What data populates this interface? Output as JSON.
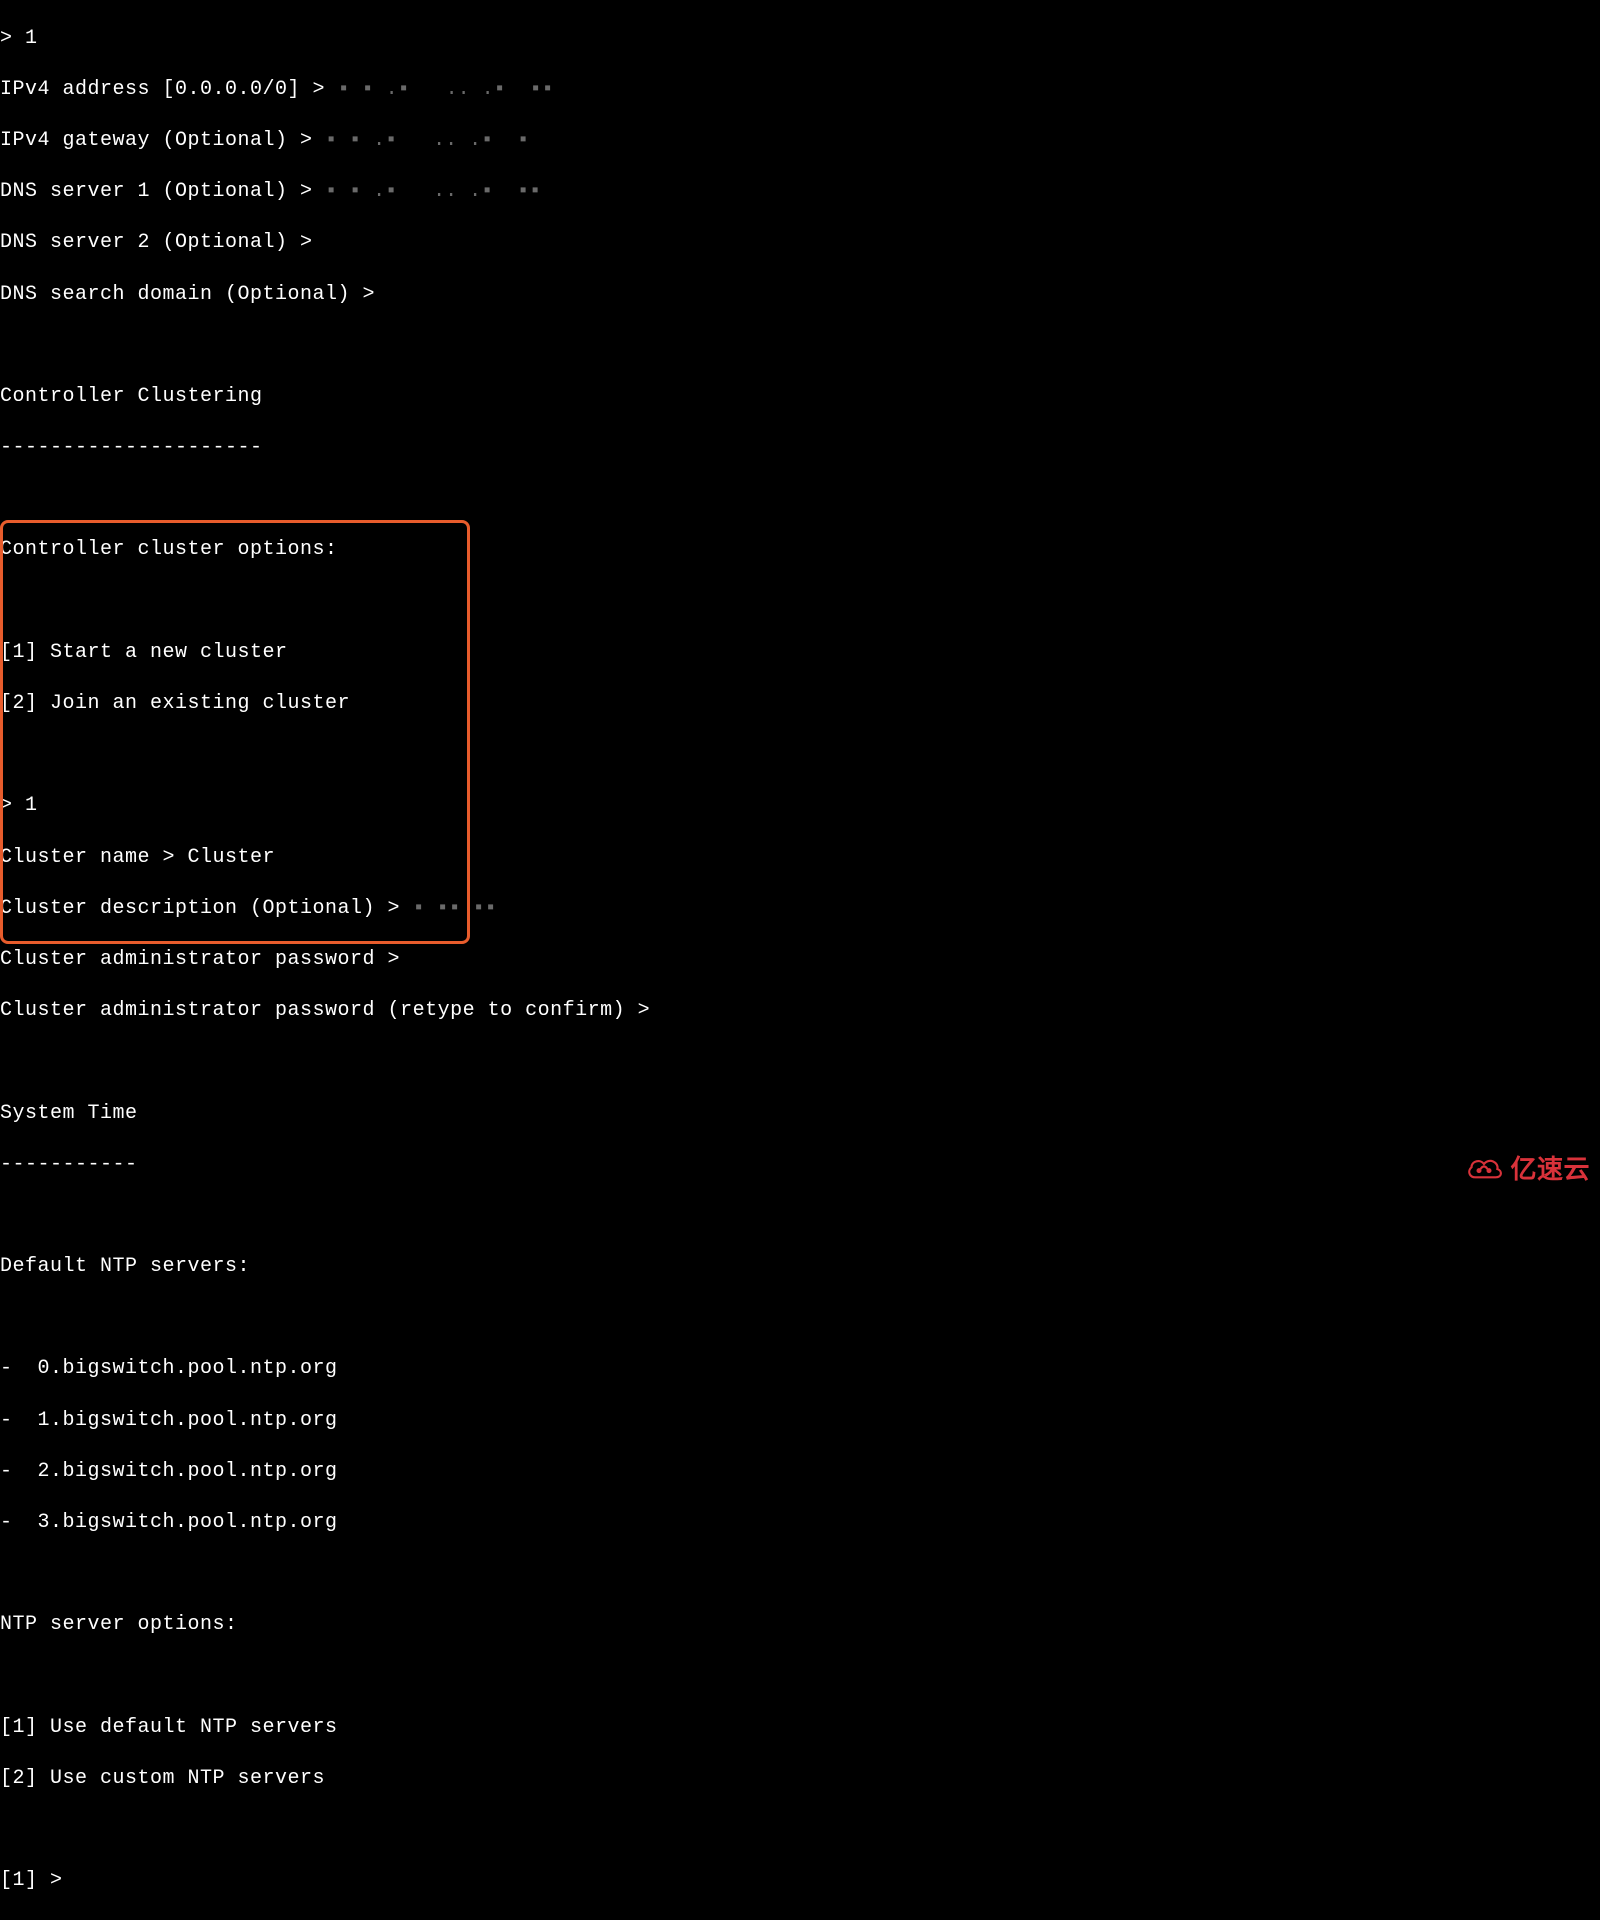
{
  "lines": {
    "l0": "> 1",
    "l1_a": "IPv4 address [0.0.0.0/0] > ",
    "l1_b": "▪ ▪ .▪   .. .▪  ▪▪",
    "l2_a": "IPv4 gateway (Optional) > ",
    "l2_b": "▪ ▪ .▪   .. .▪  ▪",
    "l3_a": "DNS server 1 (Optional) > ",
    "l3_b": "▪ ▪ .▪   .. .▪  ▪▪",
    "l4": "DNS server 2 (Optional) >",
    "l5": "DNS search domain (Optional) >",
    "l6": "",
    "l7": "Controller Clustering",
    "l8": "---------------------",
    "l9": "",
    "l10": "Controller cluster options:",
    "l11": "",
    "l12": "[1] Start a new cluster",
    "l13": "[2] Join an existing cluster",
    "l14": "",
    "l15": "> 1",
    "l16": "Cluster name > Cluster",
    "l17_a": "Cluster description (Optional) > ",
    "l17_b": "▪ ▪▪ ▪▪",
    "l18": "Cluster administrator password >",
    "l19": "Cluster administrator password (retype to confirm) >",
    "l20": "",
    "l21": "System Time",
    "l22": "-----------",
    "l23": "",
    "l24": "Default NTP servers:",
    "l25": "",
    "l26": "-  0.bigswitch.pool.ntp.org",
    "l27": "-  1.bigswitch.pool.ntp.org",
    "l28": "-  2.bigswitch.pool.ntp.org",
    "l29": "-  3.bigswitch.pool.ntp.org",
    "l30": "",
    "l31": "NTP server options:",
    "l32": "",
    "l33": "[1] Use default NTP servers",
    "l34": "[2] Use custom NTP servers",
    "l35": "",
    "l36": "[1] >"
  },
  "watermark": {
    "text": "亿速云"
  }
}
